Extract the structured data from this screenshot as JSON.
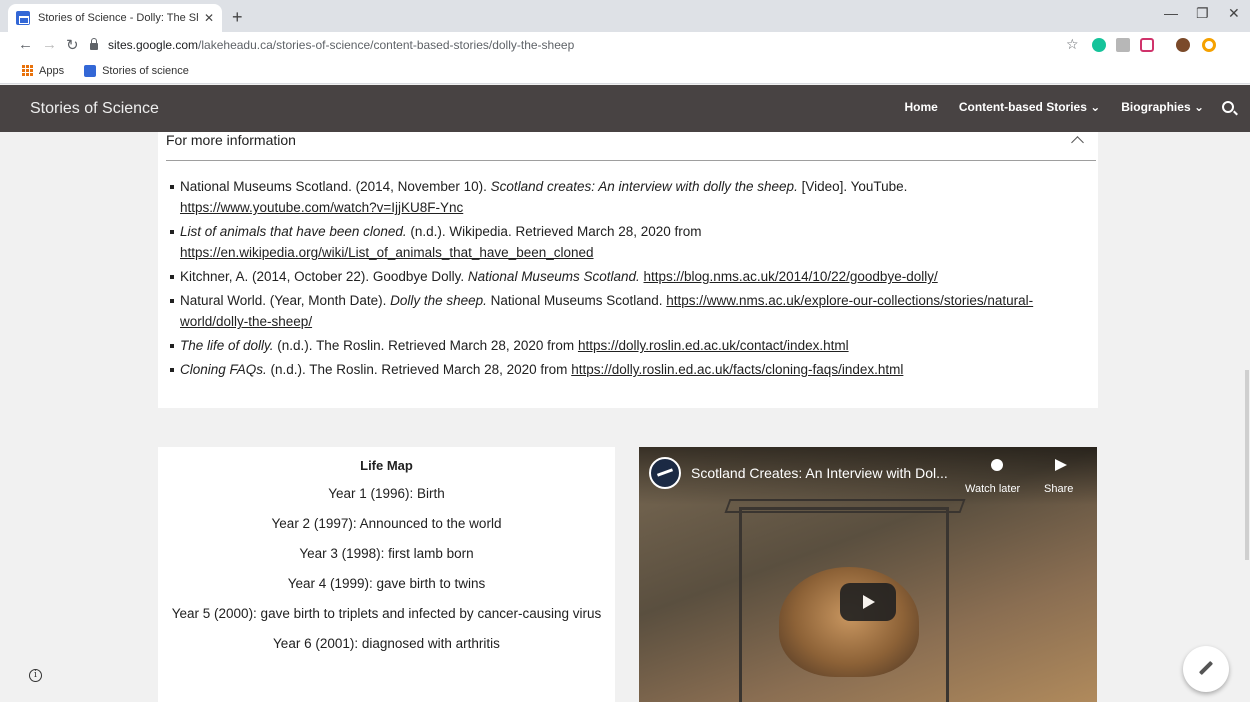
{
  "browser": {
    "tab_title": "Stories of Science - Dolly: The Sh",
    "tab_close": "✕",
    "new_tab": "+",
    "url_host": "sites.google.com",
    "url_path": "/lakeheadu.ca/stories-of-science/content-based-stories/dolly-the-sheep",
    "star": "☆",
    "window_min": "—",
    "window_max": "❐",
    "window_close": "✕",
    "back": "←",
    "forward": "→",
    "reload": "↻"
  },
  "bookmarks": {
    "apps": "Apps",
    "site": "Stories of science"
  },
  "header": {
    "site_title": "Stories of Science",
    "nav": {
      "home": "Home",
      "content": "Content-based Stories ⌄",
      "bios": "Biographies ⌄"
    }
  },
  "info": {
    "heading": "For more information",
    "refs": [
      {
        "pre": "National Museums Scotland. (2014, November 10). ",
        "ital": "Scotland creates: An interview with dolly the sheep.",
        "post": "  [Video]. YouTube.",
        "link": "https://www.youtube.com/watch?v=IjjKU8F-Ync"
      },
      {
        "pre": "",
        "ital": "List of animals that have been cloned.",
        "post": " (n.d.). Wikipedia. Retrieved March 28, 2020 from",
        "link": "https://en.wikipedia.org/wiki/List_of_animals_that_have_been_cloned"
      },
      {
        "pre": "Kitchner, A. (2014, October 22). Goodbye Dolly. ",
        "ital": "National Museums Scotland.",
        "post": " ",
        "link": "https://blog.nms.ac.uk/2014/10/22/goodbye-dolly/"
      },
      {
        "pre": "Natural World. (Year, Month Date). ",
        "ital": "Dolly the sheep.",
        "post": " National Museums Scotland.",
        "link": "https://www.nms.ac.uk/explore-our-collections/stories/natural-world/dolly-the-sheep/"
      },
      {
        "pre": "",
        "ital": "The life of dolly.",
        "post": " (n.d.). The Roslin. Retrieved March 28, 2020 from",
        "link": "https://dolly.roslin.ed.ac.uk/contact/index.html"
      },
      {
        "pre": "",
        "ital": "Cloning FAQs.",
        "post": " (n.d.). The Roslin. Retrieved March 28, 2020 from",
        "link": "https://dolly.roslin.ed.ac.uk/facts/cloning-faqs/index.html"
      }
    ]
  },
  "life_map": {
    "title": "Life Map",
    "items": [
      "Year 1 (1996): Birth",
      "Year 2 (1997): Announced to the world",
      "Year 3 (1998): first lamb born",
      "Year 4 (1999): gave birth to twins",
      "Year 5 (2000): gave birth to triplets and infected by cancer-causing virus",
      "Year 6 (2001): diagnosed with arthritis"
    ]
  },
  "video": {
    "title": "Scotland Creates: An Interview with Dol...",
    "watch_later": "Watch later",
    "share": "Share"
  },
  "colors": {
    "header_bg": "#484343",
    "page_bg": "#f1f1f1",
    "card_bg": "#ffffff"
  }
}
